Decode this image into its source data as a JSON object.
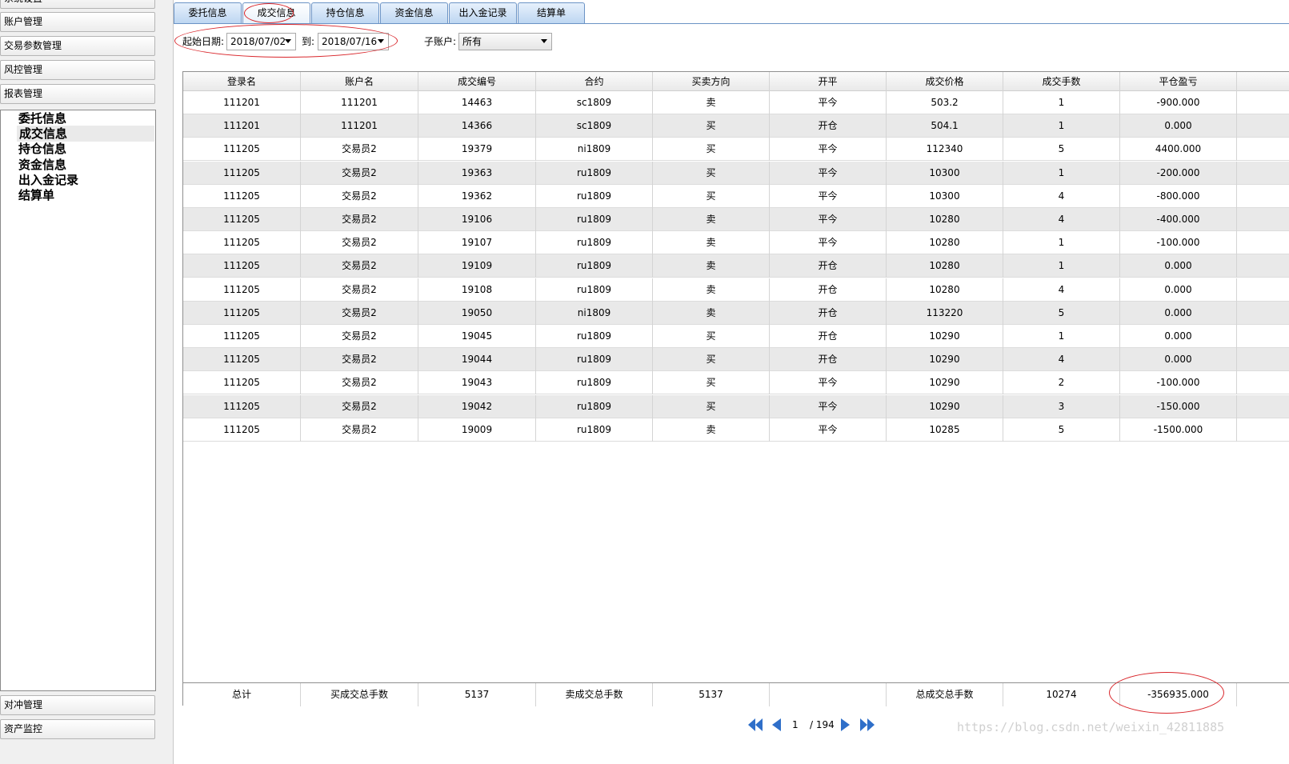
{
  "nav": {
    "sections": [
      {
        "key": "system",
        "label": "系统设置"
      },
      {
        "key": "account",
        "label": "账户管理"
      },
      {
        "key": "trade-params",
        "label": "交易参数管理"
      },
      {
        "key": "risk",
        "label": "风控管理"
      },
      {
        "key": "report",
        "label": "报表管理"
      },
      {
        "key": "hedge",
        "label": "对冲管理"
      },
      {
        "key": "asset",
        "label": "资产监控"
      }
    ],
    "report_items": [
      "委托信息",
      "成交信息",
      "持仓信息",
      "资金信息",
      "出入金记录",
      "结算单"
    ],
    "active_item": "成交信息"
  },
  "tabs": [
    "委托信息",
    "成交信息",
    "持仓信息",
    "资金信息",
    "出入金记录",
    "结算单"
  ],
  "active_tab": "成交信息",
  "filters": {
    "start_label": "起始日期:",
    "start_value": "2018/07/02",
    "to_label": "到:",
    "end_value": "2018/07/16",
    "sub_label": "子账户:",
    "sub_value": "所有"
  },
  "table": {
    "columns": [
      "登录名",
      "账户名",
      "成交编号",
      "合约",
      "买卖方向",
      "开平",
      "成交价格",
      "成交手数",
      "平仓盈亏"
    ],
    "rows": [
      [
        "111201",
        "111201",
        "14463",
        "sc1809",
        "卖",
        "平今",
        "503.2",
        "1",
        "-900.000"
      ],
      [
        "111201",
        "111201",
        "14366",
        "sc1809",
        "买",
        "开仓",
        "504.1",
        "1",
        "0.000"
      ],
      [
        "111205",
        "交易员2",
        "19379",
        "ni1809",
        "买",
        "平今",
        "112340",
        "5",
        "4400.000"
      ],
      [
        "111205",
        "交易员2",
        "19363",
        "ru1809",
        "买",
        "平今",
        "10300",
        "1",
        "-200.000"
      ],
      [
        "111205",
        "交易员2",
        "19362",
        "ru1809",
        "买",
        "平今",
        "10300",
        "4",
        "-800.000"
      ],
      [
        "111205",
        "交易员2",
        "19106",
        "ru1809",
        "卖",
        "平今",
        "10280",
        "4",
        "-400.000"
      ],
      [
        "111205",
        "交易员2",
        "19107",
        "ru1809",
        "卖",
        "平今",
        "10280",
        "1",
        "-100.000"
      ],
      [
        "111205",
        "交易员2",
        "19109",
        "ru1809",
        "卖",
        "开仓",
        "10280",
        "1",
        "0.000"
      ],
      [
        "111205",
        "交易员2",
        "19108",
        "ru1809",
        "卖",
        "开仓",
        "10280",
        "4",
        "0.000"
      ],
      [
        "111205",
        "交易员2",
        "19050",
        "ni1809",
        "卖",
        "开仓",
        "113220",
        "5",
        "0.000"
      ],
      [
        "111205",
        "交易员2",
        "19045",
        "ru1809",
        "买",
        "开仓",
        "10290",
        "1",
        "0.000"
      ],
      [
        "111205",
        "交易员2",
        "19044",
        "ru1809",
        "买",
        "开仓",
        "10290",
        "4",
        "0.000"
      ],
      [
        "111205",
        "交易员2",
        "19043",
        "ru1809",
        "买",
        "平今",
        "10290",
        "2",
        "-100.000"
      ],
      [
        "111205",
        "交易员2",
        "19042",
        "ru1809",
        "买",
        "平今",
        "10290",
        "3",
        "-150.000"
      ],
      [
        "111205",
        "交易员2",
        "19009",
        "ru1809",
        "卖",
        "平今",
        "10285",
        "5",
        "-1500.000"
      ]
    ],
    "footer": [
      "总计",
      "买成交总手数",
      "5137",
      "卖成交总手数",
      "5137",
      "",
      "总成交总手数",
      "10274",
      "-356935.000"
    ]
  },
  "pager": {
    "page": "1",
    "total": "/ 194"
  },
  "watermark": "https://blog.csdn.net/weixin_42811885",
  "colors": {
    "tab_border": "#6b93c5",
    "annotation": "#d9262b",
    "row_alt": "#e9e9e9",
    "pager_icon": "#2f6fc9"
  },
  "icons": [
    "first-page-icon",
    "prev-page-icon",
    "next-page-icon",
    "last-page-icon",
    "dropdown-arrow-icon"
  ]
}
